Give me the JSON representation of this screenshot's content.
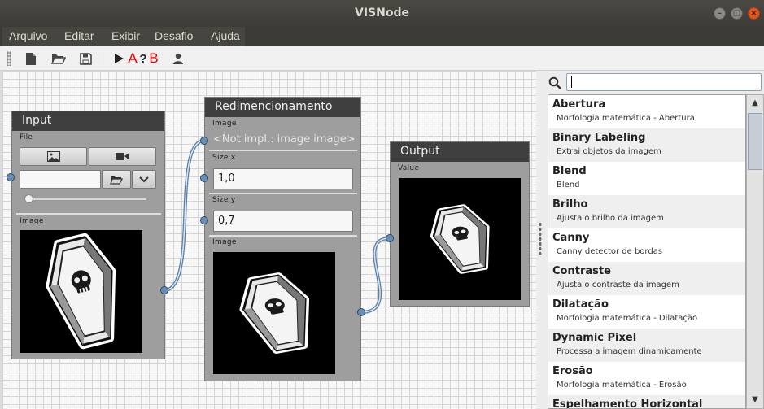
{
  "window": {
    "title": "VISNode"
  },
  "menu": [
    "Arquivo",
    "Editar",
    "Exibir",
    "Desafio",
    "Ajuda"
  ],
  "toolbar": {
    "icons": [
      "new-file-icon",
      "open-folder-icon",
      "save-icon",
      "run-icon",
      "challenge-a-icon",
      "challenge-help-b-icon",
      "user-icon"
    ],
    "run_a_label": "A",
    "help_b_q": "?",
    "help_b_label": "B"
  },
  "nodes": {
    "input": {
      "title": "Input",
      "file_label": "File",
      "file_path": "",
      "image_label": "Image"
    },
    "resize": {
      "title": "Redimencionamento",
      "image_label": "Image",
      "image_value": "<Not impl.: image image>",
      "sizex_label": "Size x",
      "sizex_value": "1,0",
      "sizey_label": "Size y",
      "sizey_value": "0,7",
      "output_label": "Image"
    },
    "output": {
      "title": "Output",
      "value_label": "Value"
    }
  },
  "search": {
    "value": ""
  },
  "node_list": [
    {
      "title": "Abertura",
      "desc": "Morfologia matemática - Abertura"
    },
    {
      "title": "Binary Labeling",
      "desc": "Extrai objetos da imagem"
    },
    {
      "title": "Blend",
      "desc": "Blend"
    },
    {
      "title": "Brilho",
      "desc": "Ajusta o brilho da imagem"
    },
    {
      "title": "Canny",
      "desc": "Canny detector de bordas"
    },
    {
      "title": "Contraste",
      "desc": "Ajusta o contraste da imagem"
    },
    {
      "title": "Dilatação",
      "desc": "Morfologia matemática - Dilatação"
    },
    {
      "title": "Dynamic Pixel",
      "desc": "Processa a imagem dinamicamente"
    },
    {
      "title": "Erosão",
      "desc": "Morfologia matemática - Erosão"
    },
    {
      "title": "Espelhamento Horizontal",
      "desc": ""
    }
  ]
}
